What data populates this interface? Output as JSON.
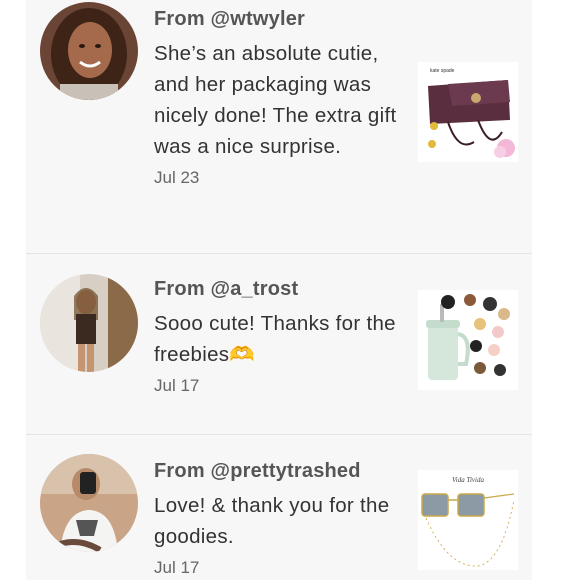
{
  "reviews": [
    {
      "from": "From @wtwyler",
      "text": "She’s an absolute cutie, and her packaging was nicely done! The extra gift was a nice surprise.",
      "date": "Jul 23",
      "thumb_icon": "purse-photo"
    },
    {
      "from": "From @a_trost",
      "text": "Sooo cute! Thanks for the freebies🫶",
      "date": "Jul 17",
      "thumb_icon": "tumbler-photo"
    },
    {
      "from": "From @prettytrashed",
      "text": "Love! & thank you for the goodies.",
      "date": "Jul 17",
      "thumb_icon": "sunglasses-photo"
    }
  ],
  "thumbs": {
    "brand_tag": "kate spade",
    "sunglasses_brand": "Vida Tivida"
  },
  "colors": {
    "panel_bg": "#f7f7f7",
    "purse": "#5a2e3f"
  }
}
